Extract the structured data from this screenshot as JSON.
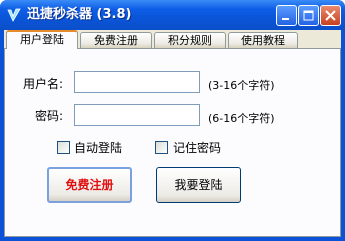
{
  "window": {
    "title": "迅捷秒杀器 (3.8)",
    "controls": {
      "minimize": "minimize",
      "maximize": "maximize",
      "close": "close"
    }
  },
  "tabs": [
    {
      "label": "用户登陆",
      "active": true
    },
    {
      "label": "免费注册",
      "active": false
    },
    {
      "label": "积分规则",
      "active": false
    },
    {
      "label": "使用教程",
      "active": false
    }
  ],
  "login_form": {
    "username_label": "用户名:",
    "username_value": "",
    "username_hint": "(3-16个字符)",
    "password_label": "密码:",
    "password_value": "",
    "password_hint": "(6-16个字符)",
    "auto_login_label": "自动登陆",
    "auto_login_checked": false,
    "remember_password_label": "记住密码",
    "remember_password_checked": false,
    "register_button": "免费注册",
    "login_button": "我要登陆"
  },
  "colors": {
    "titlebar": "#0a55d8",
    "client_bg": "#ece9d8",
    "panel_bg": "#fcfcfe",
    "register_text": "#e01010",
    "active_tab_accent": "#e68b2c"
  }
}
